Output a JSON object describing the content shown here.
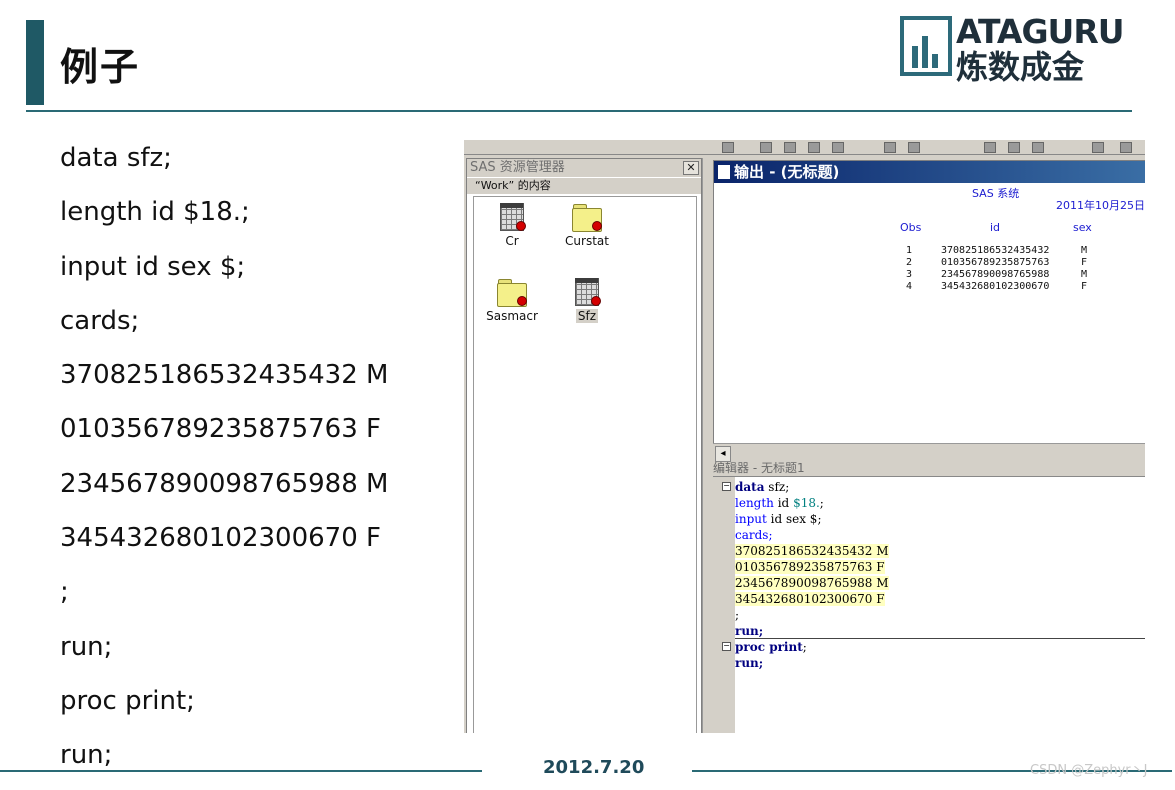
{
  "slide": {
    "title": "例子",
    "logo": {
      "en": "ATAGURU",
      "cn": "炼数成金"
    },
    "code_lines": [
      "data sfz;",
      "length id $18.;",
      "input id sex $;",
      "cards;",
      "370825186532435432 M",
      "010356789235875763 F",
      "234567890098765988 M",
      "345432680102300670 F",
      ";",
      "run;",
      "proc print;",
      "run;"
    ],
    "footer_date": "2012.7.20",
    "watermark": "CSDN @Zephyr丶J"
  },
  "sas": {
    "explorer": {
      "title": "SAS 资源管理器",
      "close": "✕",
      "subtitle": "“Work” 的内容",
      "items": [
        {
          "label": "Cr",
          "type": "table"
        },
        {
          "label": "Curstat",
          "type": "folder"
        },
        {
          "label": "Sasmacr",
          "type": "folder"
        },
        {
          "label": "Sfz",
          "type": "table"
        }
      ]
    },
    "output": {
      "title": "输出 - (无标题)",
      "system": "SAS 系统",
      "date": "2011年10月25日",
      "headers": [
        "Obs",
        "id",
        "sex"
      ],
      "rows": [
        {
          "obs": "1",
          "id": "370825186532435432",
          "sex": "M"
        },
        {
          "obs": "2",
          "id": "010356789235875763",
          "sex": "F"
        },
        {
          "obs": "3",
          "id": "234567890098765988",
          "sex": "M"
        },
        {
          "obs": "4",
          "id": "345432680102300670",
          "sex": "F"
        }
      ]
    },
    "editor": {
      "title": "编辑器 - 无标题1",
      "scroll_left": "◂",
      "fold_mark": "−",
      "lines": {
        "l1a": "data",
        "l1b": " sfz;",
        "l2a": "length",
        "l2b": " id ",
        "l2c": "$18.",
        "l2d": ";",
        "l3a": "input",
        "l3b": " id sex $;",
        "l4": "cards;",
        "l5": "370825186532435432 M",
        "l6": "010356789235875763 F",
        "l7": "234567890098765988 M",
        "l8": "345432680102300670 F",
        "l9": ";",
        "l10": "run;",
        "l11a": "proc print",
        "l11b": ";",
        "l12": "run;"
      }
    }
  }
}
